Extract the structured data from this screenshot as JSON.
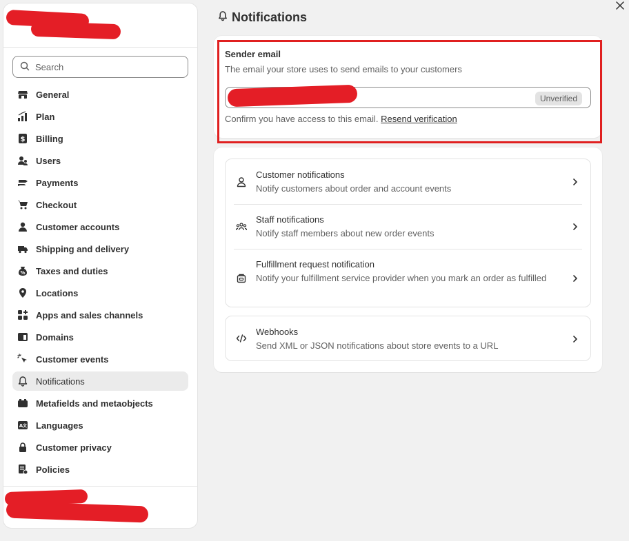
{
  "sidebar": {
    "search_placeholder": "Search",
    "items": [
      {
        "label": "General",
        "icon": "store-icon"
      },
      {
        "label": "Plan",
        "icon": "plan-chart-icon"
      },
      {
        "label": "Billing",
        "icon": "dollar-receipt-icon"
      },
      {
        "label": "Users",
        "icon": "users-icon"
      },
      {
        "label": "Payments",
        "icon": "hand-card-icon"
      },
      {
        "label": "Checkout",
        "icon": "cart-icon"
      },
      {
        "label": "Customer accounts",
        "icon": "person-icon"
      },
      {
        "label": "Shipping and delivery",
        "icon": "truck-icon"
      },
      {
        "label": "Taxes and duties",
        "icon": "tax-bag-icon"
      },
      {
        "label": "Locations",
        "icon": "location-pin-icon"
      },
      {
        "label": "Apps and sales channels",
        "icon": "apps-grid-icon"
      },
      {
        "label": "Domains",
        "icon": "globe-window-icon"
      },
      {
        "label": "Customer events",
        "icon": "cursor-click-icon"
      },
      {
        "label": "Notifications",
        "icon": "bell-icon",
        "active": true
      },
      {
        "label": "Metafields and metaobjects",
        "icon": "metafields-icon"
      },
      {
        "label": "Languages",
        "icon": "language-icon"
      },
      {
        "label": "Customer privacy",
        "icon": "lock-icon"
      },
      {
        "label": "Policies",
        "icon": "policy-doc-icon"
      }
    ]
  },
  "main": {
    "title": "Notifications",
    "sender": {
      "title": "Sender email",
      "description": "The email your store uses to send emails to your customers",
      "badge": "Unverified",
      "confirm_text": "Confirm you have access to this email.",
      "resend_link": "Resend verification"
    },
    "notification_groups": [
      {
        "title": "Customer notifications",
        "description": "Notify customers about order and account events",
        "icon": "person-outline-icon"
      },
      {
        "title": "Staff notifications",
        "description": "Notify staff members about new order events",
        "icon": "group-icon"
      },
      {
        "title": "Fulfillment request notification",
        "description": "Notify your fulfillment service provider when you mark an order as fulfilled",
        "icon": "fulfillment-box-icon"
      }
    ],
    "webhooks": {
      "title": "Webhooks",
      "description": "Send XML or JSON notifications about store events to a URL",
      "icon": "code-icon"
    }
  },
  "colors": {
    "background": "#f1f1f1",
    "card": "#ffffff",
    "text": "#303030",
    "subdued": "#616161",
    "highlight_border": "#e02020",
    "redaction": "#e41e26"
  }
}
